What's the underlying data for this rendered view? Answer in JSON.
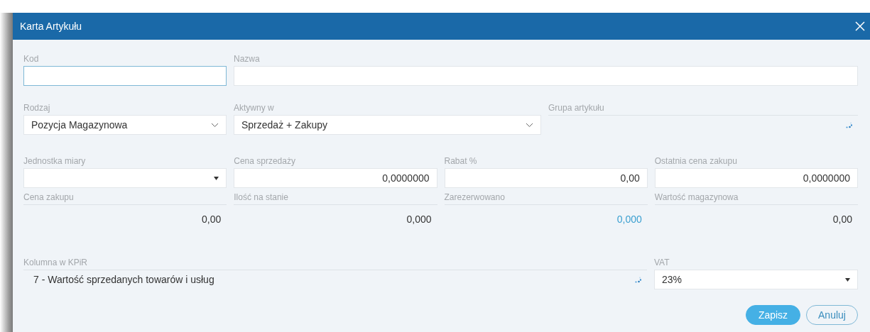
{
  "window": {
    "title": "Karta Artykułu"
  },
  "rows": [
    {
      "fields": [
        {
          "kind": "text",
          "label": "Kod",
          "focused": true
        },
        {
          "kind": "text",
          "label": "Nazwa",
          "focused": false
        }
      ]
    },
    {
      "fields": [
        {
          "kind": "select",
          "label": "Rodzaj",
          "value": "Pozycja Magazynowa"
        },
        {
          "kind": "select",
          "label": "Aktywny w",
          "value": "Sprzedaż + Zakupy"
        },
        {
          "kind": "lookup",
          "label": "Grupa artykułu"
        }
      ]
    },
    {
      "fields": [
        {
          "kind": "dropdown",
          "label": "Jednostka miary"
        },
        {
          "kind": "number",
          "label": "Cena sprzedaży",
          "value": "0,0000000"
        },
        {
          "kind": "number",
          "label": "Rabat %",
          "value": "0,00"
        },
        {
          "kind": "number",
          "label": "Ostatnia cena zakupu",
          "value": "0,0000000"
        }
      ]
    },
    {
      "fields": [
        {
          "kind": "readonly",
          "label": "Cena zakupu",
          "value": "0,00"
        },
        {
          "kind": "readonly",
          "label": "Ilość na stanie",
          "value": "0,000"
        },
        {
          "kind": "link",
          "label": "Zarezerwowano",
          "value": "0,000"
        },
        {
          "kind": "readonly",
          "label": "Wartość magazynowa",
          "value": "0,00"
        }
      ]
    },
    {
      "fields": [
        {
          "kind": "lookup",
          "label": "Kolumna w KPiR",
          "value": "7 - Wartość sprzedanych towarów i usług"
        },
        {
          "kind": "dropdown",
          "label": "VAT",
          "value": "23%"
        }
      ]
    }
  ],
  "buttons": [
    {
      "label": "Zapisz",
      "kind": "primary"
    },
    {
      "label": "Anuluj",
      "kind": "secondary"
    }
  ]
}
